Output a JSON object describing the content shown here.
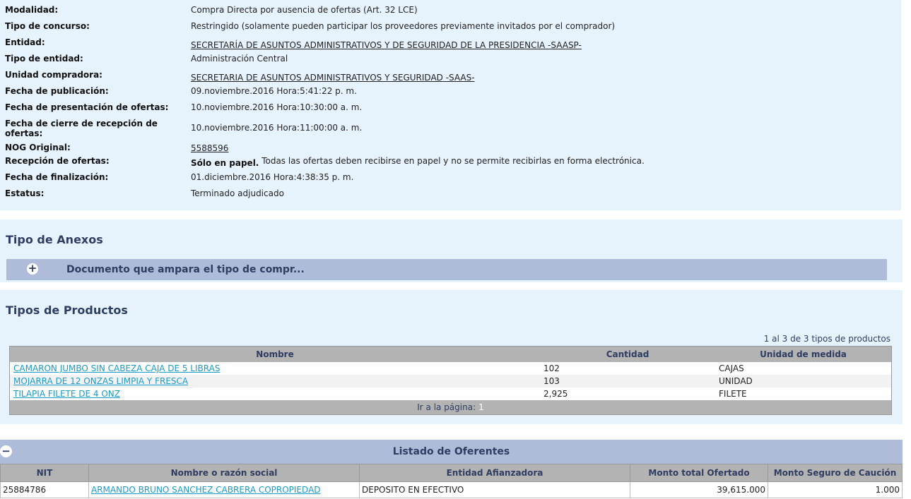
{
  "info": {
    "rows": [
      {
        "label": "Modalidad:",
        "value": "Compra Directa por ausencia de ofertas (Art. 32 LCE)"
      },
      {
        "label": "Tipo de concurso:",
        "value": "Restringido (solamente pueden participar los proveedores previamente invitados por el comprador)"
      },
      {
        "label": "Entidad:",
        "value": "SECRETARÍA DE ASUNTOS ADMINISTRATIVOS Y DE SEGURIDAD DE LA PRESIDENCIA -SAASP-"
      },
      {
        "label": "Tipo de entidad:",
        "value": "Administración Central"
      },
      {
        "label": "Unidad compradora:",
        "value": "SECRETARIA DE ASUNTOS ADMINISTRATIVOS Y SEGURIDAD -SAAS-"
      },
      {
        "label": "Fecha de publicación:",
        "value": "09.noviembre.2016 Hora:5:41:22 p. m."
      },
      {
        "label": "Fecha de presentación de ofertas:",
        "value": "10.noviembre.2016 Hora:10:30:00 a. m."
      },
      {
        "label": "Fecha de cierre de recepción de ofertas:",
        "value": "10.noviembre.2016 Hora:11:00:00 a. m."
      },
      {
        "label": "NOG Original:",
        "value": "5588596"
      },
      {
        "label": "Recepción de ofertas:",
        "value_bold": "Sólo en papel.",
        "value": "Todas las ofertas deben recibirse en papel y no se permite recibirlas en forma electrónica."
      },
      {
        "label": "Fecha de finalización:",
        "value": "01.diciembre.2016 Hora:4:38:35 p. m."
      },
      {
        "label": "Estatus:",
        "value": "Terminado adjudicado"
      }
    ]
  },
  "annex": {
    "title": "Tipo de Anexos",
    "item": "Documento que ampara el tipo de compr...",
    "icon": "plus-icon"
  },
  "products": {
    "title": "Tipos de Productos",
    "pager_info": "1 al 3 de 3 tipos de productos",
    "headers": [
      "Nombre",
      "Cantidad",
      "Unidad de medida"
    ],
    "rows": [
      {
        "name": "CAMARON JUMBO SIN CABEZA CAJA DE 5 LIBRAS",
        "qty": "102",
        "unit": "CAJAS"
      },
      {
        "name": "MOJARRA DE 12 ONZAS LIMPIA Y FRESCA",
        "qty": "103",
        "unit": "UNIDAD"
      },
      {
        "name": "TILAPIA FILETE DE 4 ONZ",
        "qty": "2,925",
        "unit": "FILETE"
      }
    ],
    "goto_label": "Ir a la página:",
    "page": "1"
  },
  "bidders": {
    "title": "Listado de Oferentes",
    "icon": "minus-icon",
    "headers": [
      "NIT",
      "Nombre o razón social",
      "Entidad Afianzadora",
      "Monto total Ofertado",
      "Monto Seguro de Caución"
    ],
    "rows": [
      {
        "nit": "25884786",
        "name": "ARMANDO BRUNO SANCHEZ CABRERA COPROPIEDAD",
        "entity": "DEPOSITO EN EFECTIVO",
        "total": "39,615.000",
        "insurance": "1.000"
      }
    ]
  },
  "colors": {
    "panel_bg": "#e7f3fc",
    "header_bar": "#aebbd9",
    "table_header": "#b3b3b3",
    "link": "#1a9bc6",
    "title": "#2f3d62"
  }
}
